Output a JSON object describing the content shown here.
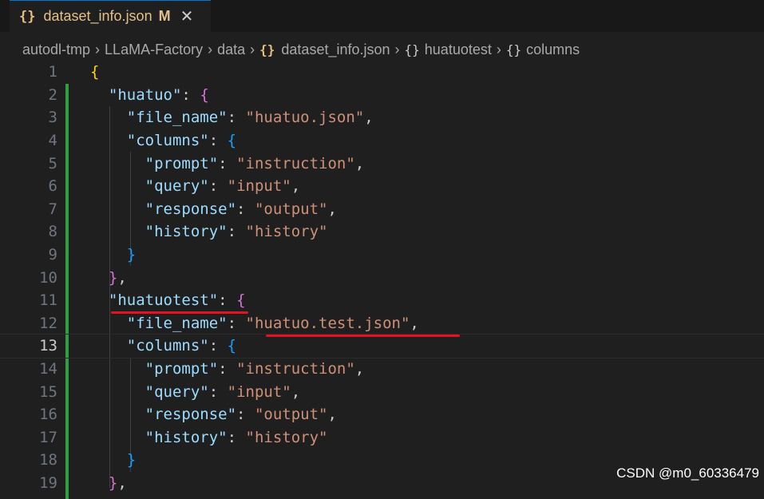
{
  "tab": {
    "icon": "{}",
    "label": "dataset_info.json",
    "modified_badge": "M",
    "close_glyph": "✕"
  },
  "breadcrumb": {
    "folder1": "autodl-tmp",
    "folder2": "LLaMA-Factory",
    "folder3": "data",
    "file_icon": "{}",
    "file": "dataset_info.json",
    "obj_icon": "{}",
    "obj1": "huatuotest",
    "obj2": "columns"
  },
  "lines": [
    {
      "n": "1",
      "t": "{"
    },
    {
      "n": "2",
      "t": "  \"huatuo\": {"
    },
    {
      "n": "3",
      "t": "    \"file_name\": \"huatuo.json\","
    },
    {
      "n": "4",
      "t": "    \"columns\": {"
    },
    {
      "n": "5",
      "t": "      \"prompt\": \"instruction\","
    },
    {
      "n": "6",
      "t": "      \"query\": \"input\","
    },
    {
      "n": "7",
      "t": "      \"response\": \"output\","
    },
    {
      "n": "8",
      "t": "      \"history\": \"history\""
    },
    {
      "n": "9",
      "t": "    }"
    },
    {
      "n": "10",
      "t": "  },"
    },
    {
      "n": "11",
      "t": "  \"huatuotest\": {"
    },
    {
      "n": "12",
      "t": "    \"file_name\": \"huatuo.test.json\","
    },
    {
      "n": "13",
      "t": "    \"columns\": {"
    },
    {
      "n": "14",
      "t": "      \"prompt\": \"instruction\","
    },
    {
      "n": "15",
      "t": "      \"query\": \"input\","
    },
    {
      "n": "16",
      "t": "      \"response\": \"output\","
    },
    {
      "n": "17",
      "t": "      \"history\": \"history\""
    },
    {
      "n": "18",
      "t": "    }"
    },
    {
      "n": "19",
      "t": "  },"
    }
  ],
  "current_line": "13",
  "watermark": "CSDN @m0_60336479",
  "colors": {
    "key": "#9cdcfe",
    "string": "#ce9178",
    "bracket_level1": "#ffd700",
    "bracket_level2": "#da70d6",
    "bracket_level3": "#179fff",
    "git_modified_bar": "#2ea043",
    "annotation_underline": "#e81123"
  }
}
